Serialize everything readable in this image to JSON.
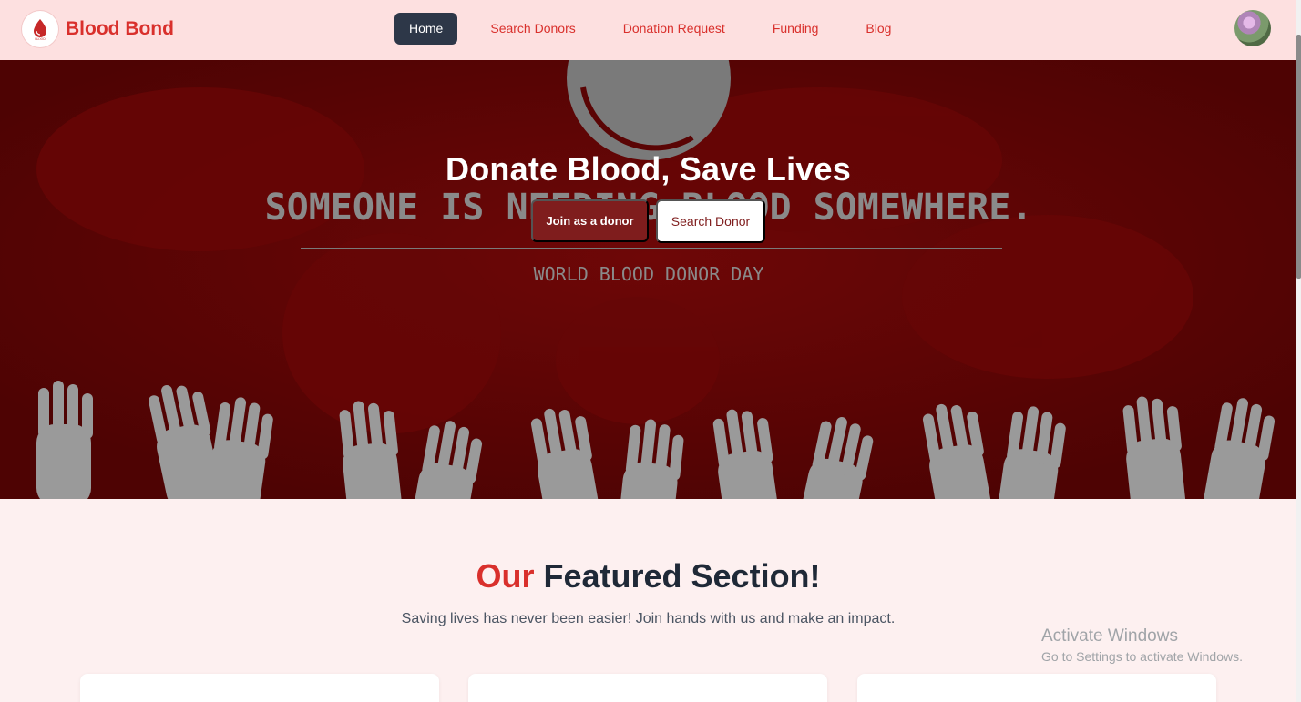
{
  "brand": {
    "name": "Blood Bond",
    "logo_text": "BLOOD"
  },
  "nav": {
    "items": [
      {
        "label": "Home",
        "active": true
      },
      {
        "label": "Search Donors"
      },
      {
        "label": "Donation Request"
      },
      {
        "label": "Funding"
      },
      {
        "label": "Blog"
      }
    ]
  },
  "hero": {
    "title": "Donate Blood, Save Lives",
    "banner_text_main": "SOMEONE IS NEEDING BLOOD SOMEWHERE.",
    "banner_text_sub": "WORLD BLOOD DONOR DAY",
    "primary_button": "Join as a donor",
    "secondary_button": "Search Donor"
  },
  "featured": {
    "title_accent": "Our",
    "title_rest": "Featured Section!",
    "subtitle": "Saving lives has never been easier! Join hands with us and make an impact."
  },
  "os_watermark": {
    "title": "Activate Windows",
    "subtitle": "Go to Settings to activate Windows."
  },
  "colors": {
    "accent": "#d9302c",
    "nav_bg": "#fde0e0",
    "hero_bg": "#5a0404",
    "dark": "#2d3748",
    "page_bg": "#fdf0f0"
  }
}
